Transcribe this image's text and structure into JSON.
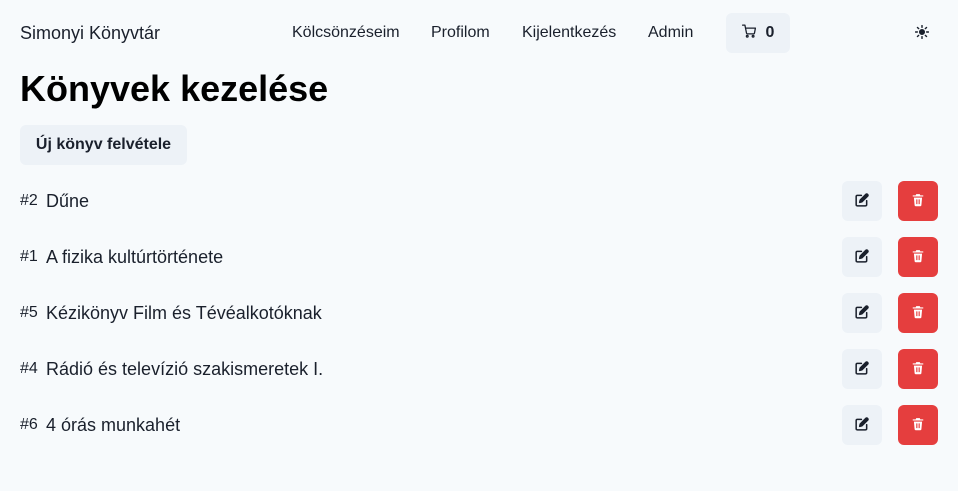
{
  "nav": {
    "brand": "Simonyi Könyvtár",
    "links": [
      {
        "label": "Kölcsönzéseim",
        "name": "nav-link-loans"
      },
      {
        "label": "Profilom",
        "name": "nav-link-profile"
      },
      {
        "label": "Kijelentkezés",
        "name": "nav-link-logout"
      },
      {
        "label": "Admin",
        "name": "nav-link-admin"
      }
    ],
    "cart": {
      "icon": "cart-icon",
      "count": "0"
    },
    "theme_toggle": {
      "icon": "sun-icon"
    }
  },
  "page": {
    "title": "Könyvek kezelése",
    "new_book_label": "Új könyv felvétele"
  },
  "books": [
    {
      "id": "#2",
      "title": "Dűne"
    },
    {
      "id": "#1",
      "title": "A fizika kultúrtörténete"
    },
    {
      "id": "#5",
      "title": "Kézikönyv Film és Tévéalkotóknak"
    },
    {
      "id": "#4",
      "title": "Rádió és televízió szakismeretek I."
    },
    {
      "id": "#6",
      "title": "4 órás munkahét"
    }
  ],
  "row_actions": {
    "edit_icon": "edit-icon",
    "delete_icon": "trash-icon"
  },
  "colors": {
    "background": "#f7fafc",
    "button_gray": "#edf2f7",
    "danger": "#e53e3e",
    "text": "#1a202c"
  }
}
